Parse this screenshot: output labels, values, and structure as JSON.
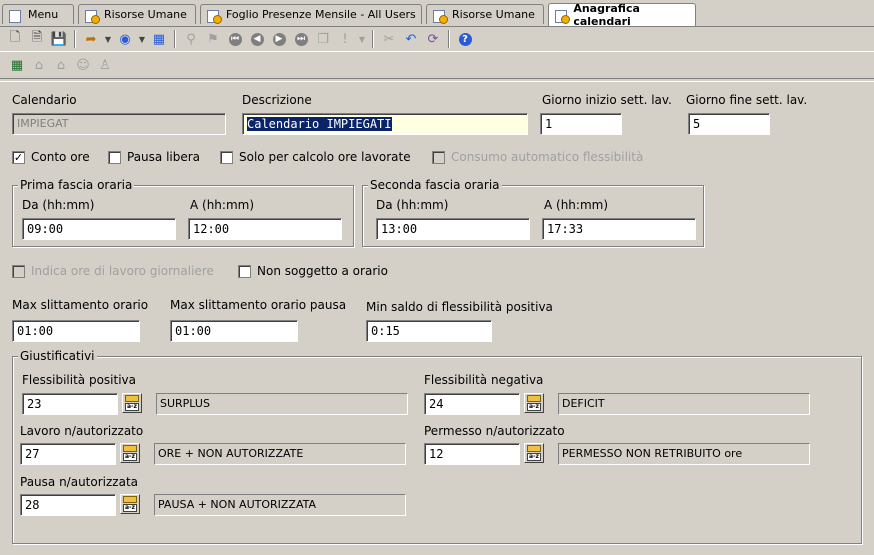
{
  "tabs": [
    {
      "label": "Menu"
    },
    {
      "label": "Risorse Umane"
    },
    {
      "label": "Foglio Presenze Mensile - All Users"
    },
    {
      "label": "Risorse Umane"
    },
    {
      "label": "Anagrafica calendari"
    }
  ],
  "form": {
    "calendario": {
      "label": "Calendario",
      "value": "IMPIEGAT"
    },
    "descrizione": {
      "label": "Descrizione",
      "value": "Calendario IMPIEGATI"
    },
    "giorno_inizio": {
      "label": "Giorno inizio sett. lav.",
      "value": "1"
    },
    "giorno_fine": {
      "label": "Giorno fine sett. lav.",
      "value": "5"
    },
    "checks": {
      "conto_ore": "Conto ore",
      "pausa_libera": "Pausa libera",
      "solo_calcolo": "Solo per calcolo ore lavorate",
      "consumo": "Consumo automatico flessibilità"
    },
    "prima_fascia": {
      "legend": "Prima fascia oraria",
      "da_label": "Da (hh:mm)",
      "da": "09:00",
      "a_label": "A (hh:mm)",
      "a": "12:00"
    },
    "seconda_fascia": {
      "legend": "Seconda fascia oraria",
      "da_label": "Da (hh:mm)",
      "da": "13:00",
      "a_label": "A (hh:mm)",
      "a": "17:33"
    },
    "checks2": {
      "indica_ore": "Indica ore di lavoro giornaliere",
      "non_soggetto": "Non soggetto a orario"
    },
    "max_slitt": {
      "label": "Max slittamento orario",
      "value": "01:00"
    },
    "max_slitt_pausa": {
      "label": "Max slittamento orario pausa",
      "value": "01:00"
    },
    "min_saldo": {
      "label": "Min saldo di flessibilità positiva",
      "value": "0:15"
    },
    "giustificativi": {
      "legend": "Giustificativi",
      "fless_pos": {
        "label": "Flessibilità positiva",
        "code": "23",
        "desc": "SURPLUS"
      },
      "fless_neg": {
        "label": "Flessibilità negativa",
        "code": "24",
        "desc": "DEFICIT"
      },
      "lavoro": {
        "label": "Lavoro n/autorizzato",
        "code": "27",
        "desc": "ORE + NON AUTORIZZATE"
      },
      "permesso": {
        "label": "Permesso n/autorizzato",
        "code": "12",
        "desc": "PERMESSO NON RETRIBUITO ore"
      },
      "pausa": {
        "label": "Pausa n/autorizzata",
        "code": "28",
        "desc": "PAUSA + NON AUTORIZZATA"
      }
    }
  },
  "state": {
    "conto_ore_checked": "✓"
  }
}
